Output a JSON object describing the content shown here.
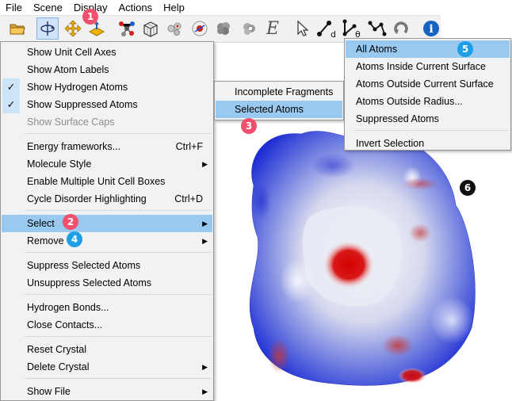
{
  "menubar": {
    "items": [
      "File",
      "Scene",
      "Display",
      "Actions",
      "Help"
    ]
  },
  "toolbar": {
    "icons": [
      "open-folder-icon",
      "rotate-icon",
      "translate-icon",
      "zoom-icon",
      "molecule-icon",
      "unit-cell-icon",
      "atom-cluster-icon",
      "nucleus-icon",
      "cloud-icon",
      "cloud-shade-icon",
      "energy-e-icon",
      "pointer-icon",
      "distance-icon",
      "angle-icon",
      "torsion-icon",
      "undo-icon",
      "help-icon"
    ],
    "energy_letter": "E",
    "distance_sub": "d",
    "angle_sub": "θ",
    "help_glyph": "i"
  },
  "display_menu": {
    "items": [
      {
        "label": "Show Unit Cell Axes"
      },
      {
        "label": "Show Atom Labels"
      },
      {
        "label": "Show Hydrogen Atoms",
        "checked": true
      },
      {
        "label": "Show Suppressed Atoms",
        "checked": true
      },
      {
        "label": "Show Surface Caps",
        "disabled": true
      },
      {
        "label": "Energy frameworks...",
        "shortcut": "Ctrl+F"
      },
      {
        "label": "Molecule Style",
        "submenu": true
      },
      {
        "label": "Enable Multiple Unit Cell Boxes"
      },
      {
        "label": "Cycle Disorder Highlighting",
        "shortcut": "Ctrl+D"
      },
      {
        "label": "Select",
        "submenu": true,
        "highlighted": true
      },
      {
        "label": "Remove",
        "submenu": true
      },
      {
        "label": "Suppress Selected Atoms"
      },
      {
        "label": "Unsuppress Selected Atoms"
      },
      {
        "label": "Hydrogen Bonds..."
      },
      {
        "label": "Close Contacts..."
      },
      {
        "label": "Reset Crystal"
      },
      {
        "label": "Delete Crystal",
        "submenu": true
      },
      {
        "label": "Show File",
        "submenu": true
      }
    ],
    "check_glyph": "✓",
    "arrow_glyph": "▶"
  },
  "select_submenu": {
    "items": [
      {
        "label": "Incomplete Fragments"
      },
      {
        "label": "Selected Atoms",
        "highlighted": true
      }
    ]
  },
  "selected_atoms_submenu": {
    "items": [
      {
        "label": "All Atoms",
        "highlighted": true
      },
      {
        "label": "Atoms Inside Current Surface"
      },
      {
        "label": "Atoms Outside Current Surface"
      },
      {
        "label": "Atoms Outside Radius..."
      },
      {
        "label": "Suppressed Atoms"
      },
      {
        "label": "Invert Selection"
      }
    ]
  },
  "badges": [
    "1",
    "2",
    "3",
    "4",
    "5",
    "6"
  ],
  "colors": {
    "surface_blue": "#1f2fd6",
    "surface_red": "#d40000",
    "surface_white": "#f4f4f8",
    "menu_highlight": "#99c9ef"
  }
}
